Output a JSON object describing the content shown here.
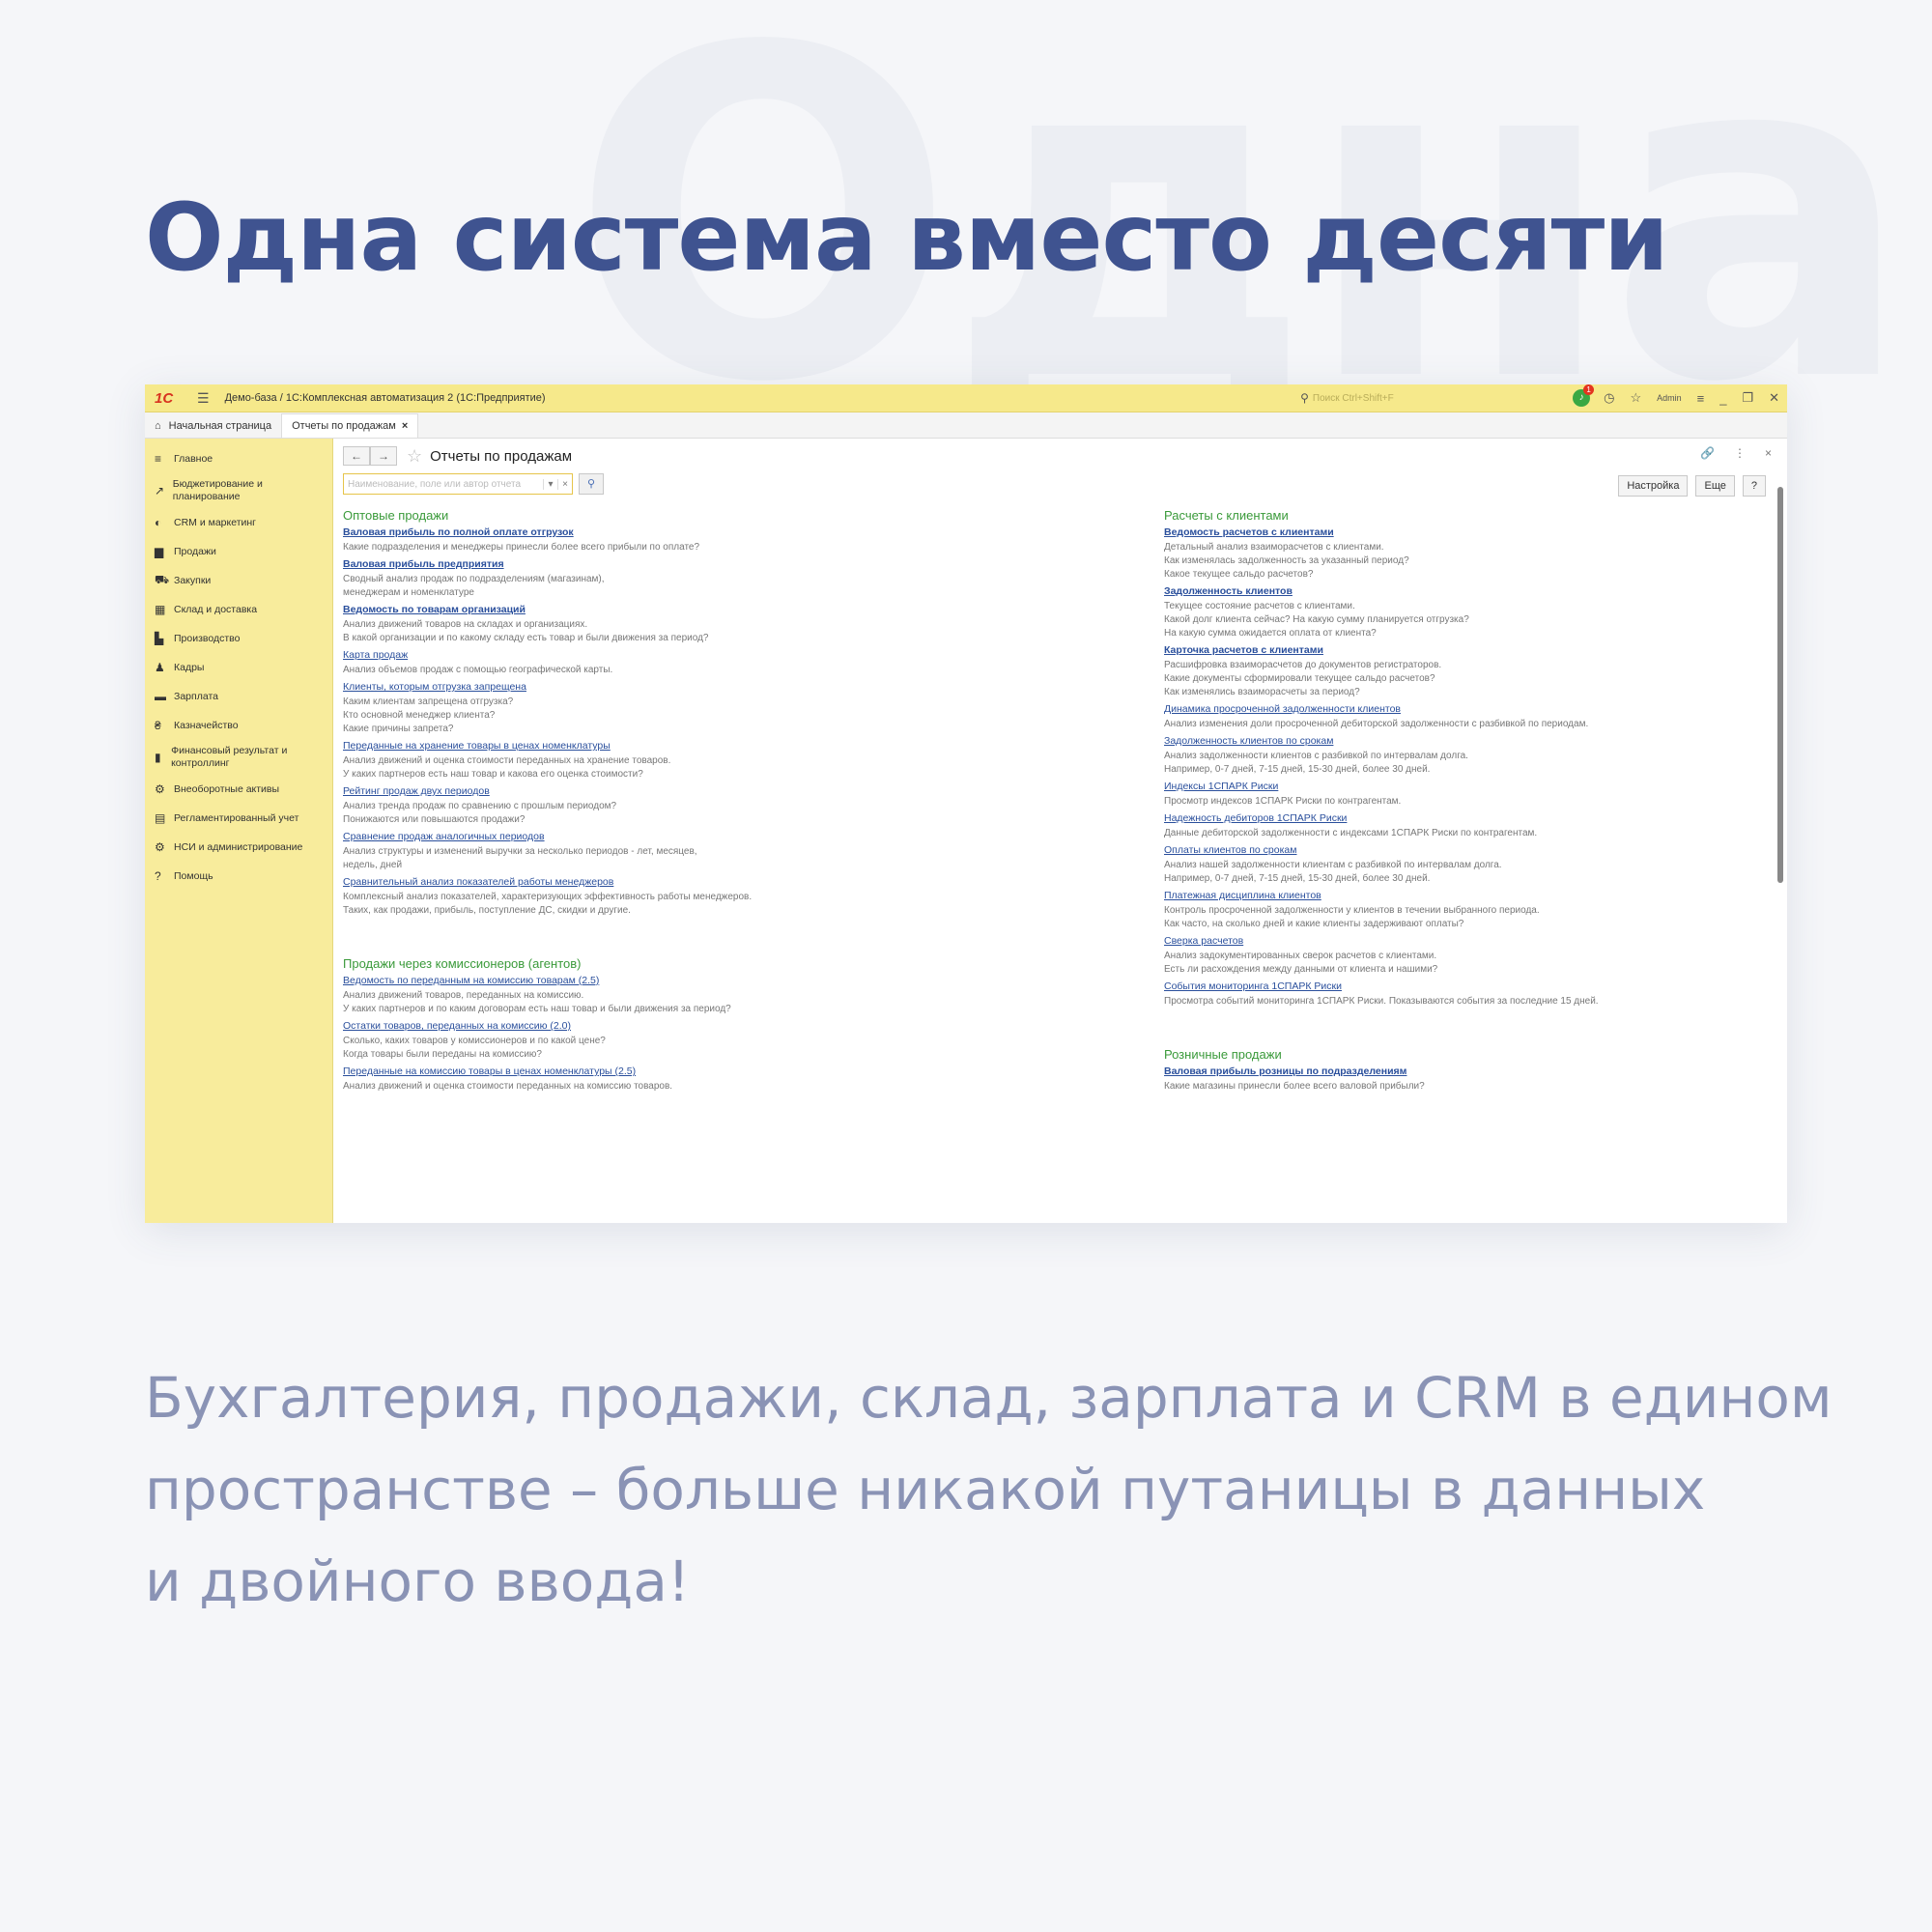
{
  "watermark": "Одна",
  "headline": "Одна система вместо десяти",
  "subtext": [
    "Бухгалтерия, продажи, склад, зарплата и CRM в едином",
    "пространстве – больше никакой путаницы в данных",
    "и двойного ввода!"
  ],
  "app": {
    "logo": "1С",
    "window_title": "Демо-база / 1С:Комплексная автоматизация 2  (1С:Предприятие)",
    "search_placeholder": "Поиск Ctrl+Shift+F",
    "notification_count": "1",
    "user": "Admin",
    "tabs": {
      "home": "Начальная страница",
      "active": "Отчеты по продажам"
    },
    "sidebar": [
      {
        "icon": "menu-icon",
        "glyph": "≡",
        "label": "Главное"
      },
      {
        "icon": "budget-icon",
        "glyph": "↗",
        "label": "Бюджетирование и планирование"
      },
      {
        "icon": "crm-icon",
        "glyph": "◐",
        "label": "CRM и маркетинг"
      },
      {
        "icon": "sales-icon",
        "glyph": "▆",
        "label": "Продажи"
      },
      {
        "icon": "cart-icon",
        "glyph": "⛟",
        "label": "Закупки"
      },
      {
        "icon": "warehouse-icon",
        "glyph": "▦",
        "label": "Склад и доставка"
      },
      {
        "icon": "factory-icon",
        "glyph": "▙",
        "label": "Производство"
      },
      {
        "icon": "person-icon",
        "glyph": "♟",
        "label": "Кадры"
      },
      {
        "icon": "salary-icon",
        "glyph": "▬",
        "label": "Зарплата"
      },
      {
        "icon": "treasury-icon",
        "glyph": "₴",
        "label": "Казначейство"
      },
      {
        "icon": "finance-icon",
        "glyph": "▮",
        "label": "Финансовый результат и контроллинг"
      },
      {
        "icon": "assets-icon",
        "glyph": "⚙",
        "label": "Внеоборотные активы"
      },
      {
        "icon": "regulated-icon",
        "glyph": "▤",
        "label": "Регламентированный учет"
      },
      {
        "icon": "admin-icon",
        "glyph": "⚙",
        "label": "НСИ и администрирование"
      },
      {
        "icon": "help-icon",
        "glyph": "?",
        "label": "Помощь"
      }
    ],
    "page_title": "Отчеты по продажам",
    "report_search_placeholder": "Наименование, поле или автор отчета",
    "settings_button": "Настройка",
    "more_button": "Еще",
    "help_button": "?",
    "left_column": [
      {
        "section": "Оптовые продажи",
        "items": [
          {
            "title": "Валовая прибыль по полной оплате отгрузок",
            "bold": true,
            "desc": [
              "Какие подразделения и менеджеры принесли более всего прибыли по оплате?"
            ]
          },
          {
            "title": "Валовая прибыль предприятия",
            "bold": true,
            "desc": [
              "Сводный анализ продаж по подразделениям (магазинам),",
              "менеджерам и номенклатуре"
            ]
          },
          {
            "title": "Ведомость по товарам организаций",
            "bold": true,
            "desc": [
              "Анализ движений товаров на складах и организациях.",
              "В какой организации и по какому складу есть товар и были движения за период?"
            ]
          },
          {
            "title": "Карта продаж",
            "bold": false,
            "desc": [
              "Анализ объемов продаж с помощью географической карты."
            ]
          },
          {
            "title": "Клиенты, которым отгрузка запрещена",
            "bold": false,
            "desc": [
              "Каким клиентам запрещена отгрузка?",
              "Кто основной менеджер клиента?",
              "Какие причины запрета?"
            ]
          },
          {
            "title": "Переданные на хранение товары в ценах номенклатуры",
            "bold": false,
            "desc": [
              "Анализ движений и оценка стоимости переданных на хранение товаров.",
              "У каких партнеров есть наш товар и какова его оценка стоимости?"
            ]
          },
          {
            "title": "Рейтинг продаж двух периодов",
            "bold": false,
            "desc": [
              "Анализ тренда продаж по сравнению с прошлым периодом?",
              "Понижаются или повышаются продажи?"
            ]
          },
          {
            "title": "Сравнение продаж аналогичных периодов",
            "bold": false,
            "desc": [
              "Анализ структуры и изменений выручки за несколько периодов - лет, месяцев,",
              "недель, дней"
            ]
          },
          {
            "title": "Сравнительный анализ показателей работы менеджеров",
            "bold": false,
            "desc": [
              "Комплексный анализ показателей, характеризующих эффективность работы менеджеров.",
              "Таких, как продажи, прибыль, поступление ДС, скидки и другие."
            ]
          }
        ]
      },
      {
        "section": "Продажи через комиссионеров (агентов)",
        "items": [
          {
            "title": "Ведомость по переданным на комиссию товарам (2.5)",
            "bold": false,
            "desc": [
              "Анализ движений товаров, переданных на комиссию.",
              "У каких партнеров и по каким договорам есть наш товар и были движения за период?"
            ]
          },
          {
            "title": "Остатки товаров, переданных на комиссию (2.0)",
            "bold": false,
            "desc": [
              "Сколько, каких товаров у комиссионеров и по какой цене?",
              "Когда товары были переданы на комиссию?"
            ]
          },
          {
            "title": "Переданные на комиссию товары в ценах номенклатуры (2.5)",
            "bold": false,
            "desc": [
              "Анализ движений и оценка стоимости переданных на комиссию товаров."
            ]
          }
        ]
      }
    ],
    "right_column": [
      {
        "section": "Расчеты с клиентами",
        "items": [
          {
            "title": "Ведомость расчетов с клиентами",
            "bold": true,
            "desc": [
              "Детальный анализ взаиморасчетов с клиентами.",
              "Как изменялась задолженность за указанный период?",
              "Какое текущее сальдо расчетов?"
            ]
          },
          {
            "title": "Задолженность клиентов",
            "bold": true,
            "desc": [
              "Текущее состояние расчетов с клиентами.",
              "Какой долг клиента сейчас? На какую сумму планируется отгрузка?",
              "На какую сумма ожидается оплата от клиента?"
            ]
          },
          {
            "title": "Карточка расчетов с клиентами",
            "bold": true,
            "desc": [
              "Расшифровка взаиморасчетов до документов регистраторов.",
              "Какие документы сформировали текущее сальдо расчетов?",
              "Как изменялись взаиморасчеты за период?"
            ]
          },
          {
            "title": "Динамика просроченной задолженности клиентов",
            "bold": false,
            "desc": [
              "Анализ изменения доли просроченной дебиторской задолженности с разбивкой по периодам."
            ]
          },
          {
            "title": "Задолженность клиентов по срокам",
            "bold": false,
            "desc": [
              "Анализ задолженности клиентов с разбивкой по интервалам долга.",
              "Например, 0-7 дней, 7-15 дней, 15-30 дней, более 30 дней."
            ]
          },
          {
            "title": "Индексы 1СПАРК Риски",
            "bold": false,
            "desc": [
              "Просмотр индексов 1СПАРК Риски по контрагентам."
            ]
          },
          {
            "title": "Надежность дебиторов 1СПАРК Риски",
            "bold": false,
            "desc": [
              "Данные дебиторской задолженности с индексами 1СПАРК Риски по контрагентам."
            ]
          },
          {
            "title": "Оплаты клиентов по срокам",
            "bold": false,
            "desc": [
              "Анализ нашей задолженности клиентам с разбивкой по интервалам долга.",
              "Например, 0-7 дней, 7-15 дней, 15-30 дней, более 30 дней."
            ]
          },
          {
            "title": "Платежная дисциплина клиентов",
            "bold": false,
            "desc": [
              "Контроль просроченной задолженности у клиентов в течении выбранного периода.",
              "Как часто, на сколько дней и какие клиенты задерживают оплаты?"
            ]
          },
          {
            "title": "Сверка расчетов",
            "bold": false,
            "desc": [
              "Анализ задокументированных сверок расчетов с клиентами.",
              "Есть ли расхождения между данными от клиента и нашими?"
            ]
          },
          {
            "title": "События мониторинга 1СПАРК Риски",
            "bold": false,
            "desc": [
              "Просмотра событий мониторинга 1СПАРК Риски. Показываются события за последние 15 дней."
            ]
          }
        ]
      },
      {
        "section": "Розничные продажи",
        "items": [
          {
            "title": "Валовая прибыль розницы по подразделениям",
            "bold": true,
            "desc": [
              "Какие магазины принесли более всего валовой прибыли?"
            ]
          }
        ]
      }
    ]
  }
}
